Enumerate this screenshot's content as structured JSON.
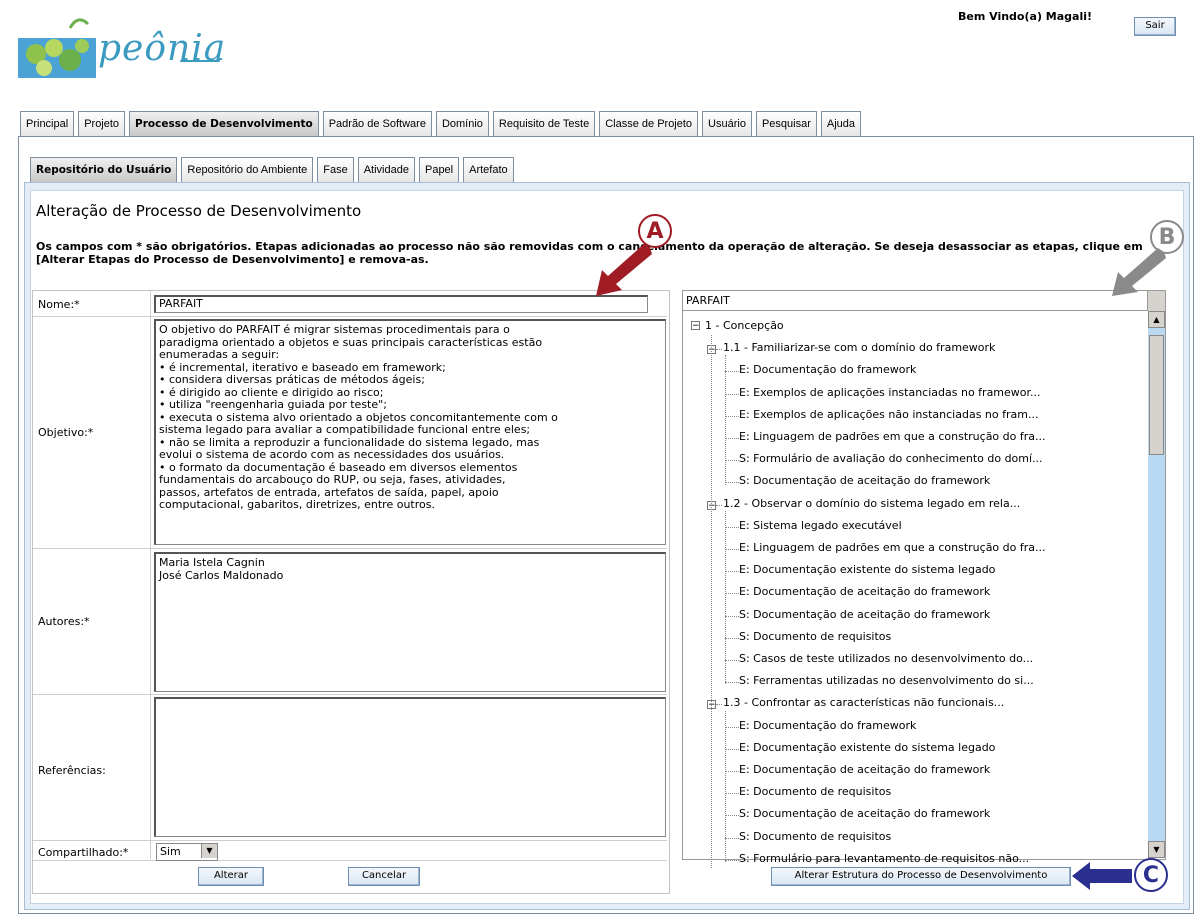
{
  "header": {
    "logo_text": "peônia",
    "welcome": "Bem Vindo(a) Magali!",
    "logout_label": "Sair"
  },
  "main_tabs": [
    "Principal",
    "Projeto",
    "Processo de Desenvolvimento",
    "Padrão de Software",
    "Domínio",
    "Requisito de Teste",
    "Classe de Projeto",
    "Usuário",
    "Pesquisar",
    "Ajuda"
  ],
  "sub_tabs": [
    "Repositório do Usuário",
    "Repositório do Ambiente",
    "Fase",
    "Atividade",
    "Papel",
    "Artefato"
  ],
  "page": {
    "title": "Alteração de Processo de Desenvolvimento",
    "note": "Os campos com * são obrigatórios. Etapas adicionadas ao processo não são removidas com o cancelamento da operação de alteração. Se deseja desassociar as etapas, clique em [Alterar Etapas do Processo de Desenvolvimento] e remova-as."
  },
  "form": {
    "nome_label": "Nome:*",
    "nome_value": "PARFAIT",
    "objetivo_label": "Objetivo:*",
    "objetivo_value": "O objetivo do PARFAIT é migrar sistemas procedimentais para o\nparadigma orientado a objetos e suas principais características estão\nenumeradas a seguir:\n• é incremental, iterativo e baseado em framework;\n• considera diversas práticas de métodos ágeis;\n• é dirigido ao cliente e dirigido ao risco;\n• utiliza \"reengenharia guiada por teste\";\n• executa o sistema alvo orientado a objetos concomitantemente com o\nsistema legado para avaliar a compatibilidade funcional entre eles;\n• não se limita a reproduzir a funcionalidade do sistema legado, mas\nevolui o sistema de acordo com as necessidades dos usuários.\n• o formato da documentação é baseado em diversos elementos\nfundamentais do arcabouço do RUP, ou seja, fases, atividades,\npassos, artefatos de entrada, artefatos de saída, papel, apoio\ncomputacional, gabaritos, diretrizes, entre outros.",
    "autores_label": "Autores:*",
    "autores_value": "Maria Istela Cagnin\nJosé Carlos Maldonado",
    "referencias_label": "Referências:",
    "referencias_value": "",
    "compartilhado_label": "Compartilhado:*",
    "compartilhado_value": "Sim",
    "alterar_label": "Alterar",
    "cancelar_label": "Cancelar"
  },
  "tree": {
    "header": "PARFAIT",
    "root": "1 - Concepção",
    "groups": [
      {
        "label": "1.1 - Familiarizar-se com o domínio do framework",
        "items": [
          "E: Documentação do framework",
          "E: Exemplos de aplicações instanciadas no framewor...",
          "E: Exemplos de aplicações não instanciadas no fram...",
          "E: Linguagem de padrões em que a construção do fra...",
          "S: Formulário de avaliação do conhecimento do domí...",
          "S: Documentação de aceitação do framework"
        ]
      },
      {
        "label": "1.2 - Observar o domínio do sistema legado em rela...",
        "items": [
          "E: Sistema legado executável",
          "E: Linguagem de padrões em que a construção do fra...",
          "E: Documentação existente do sistema legado",
          "E: Documentação de aceitação do framework",
          "S: Documentação de aceitação do framework",
          "S: Documento de requisitos",
          "S: Casos de teste utilizados no desenvolvimento do...",
          "S: Ferramentas utilizadas no desenvolvimento do si..."
        ]
      },
      {
        "label": "1.3 - Confrontar as características não funcionais...",
        "items": [
          "E: Documentação do framework",
          "E: Documentação existente do sistema legado",
          "E: Documentação de aceitação do framework",
          "E: Documento de requisitos",
          "S: Documentação de aceitação do framework",
          "S: Documento de requisitos",
          "S: Formulário para levantamento de requisitos não..."
        ]
      }
    ],
    "alter_structure_label": "Alterar Estrutura do Processo de Desenvolvimento"
  },
  "callouts": {
    "a": "A",
    "b": "B",
    "c": "C"
  },
  "colors": {
    "callout_red": "#a01c24",
    "callout_gray": "#8a8a8a",
    "callout_blue": "#2b2f8f",
    "scroll_track": "#b9d9f2"
  }
}
